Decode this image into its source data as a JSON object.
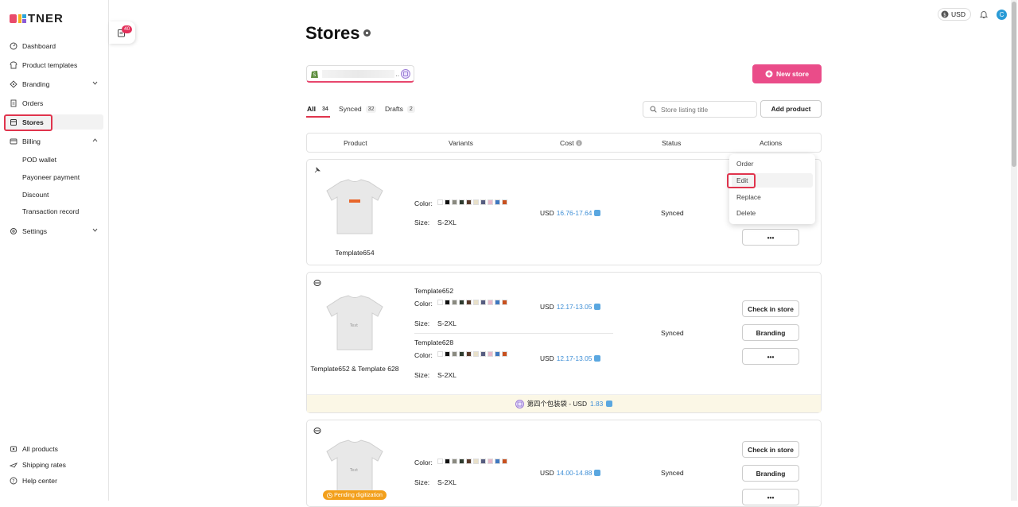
{
  "brand": {
    "name": "TNER",
    "logo_prefix": "PO"
  },
  "sidebar": {
    "items": [
      {
        "label": "Dashboard",
        "icon": "dashboard-icon"
      },
      {
        "label": "Product templates",
        "icon": "shirt-icon"
      },
      {
        "label": "Branding",
        "icon": "tag-icon"
      },
      {
        "label": "Orders",
        "icon": "orders-icon"
      },
      {
        "label": "Stores",
        "icon": "store-icon"
      },
      {
        "label": "Billing",
        "icon": "card-icon"
      },
      {
        "label": "Settings",
        "icon": "gear-icon"
      }
    ],
    "billing_sub": [
      "POD wallet",
      "Payoneer payment",
      "Discount",
      "Transaction record"
    ],
    "bottom": [
      {
        "label": "All products",
        "icon": "products-icon"
      },
      {
        "label": "Shipping rates",
        "icon": "shipping-icon"
      },
      {
        "label": "Help center",
        "icon": "help-icon"
      }
    ]
  },
  "notifications": {
    "count": "40"
  },
  "topbar": {
    "currency": "USD",
    "avatar": "C"
  },
  "page": {
    "title": "Stores"
  },
  "new_store_label": "New store",
  "tabs": [
    {
      "label": "All",
      "count": "34"
    },
    {
      "label": "Synced",
      "count": "32"
    },
    {
      "label": "Drafts",
      "count": "2"
    }
  ],
  "search": {
    "placeholder": "Store listing title"
  },
  "add_product_label": "Add product",
  "table_headers": [
    "Product",
    "Variants",
    "Cost",
    "Status",
    "Actions"
  ],
  "rows": [
    {
      "product": "Template654",
      "color_label": "Color:",
      "size_label": "Size:",
      "size": "S-2XL",
      "currency": "USD",
      "cost": "16.76-17.64",
      "status": "Synced"
    },
    {
      "product": "Template652 & Template 628",
      "variants": [
        {
          "name": "Template652",
          "size": "S-2XL",
          "currency": "USD",
          "cost": "12.17-13.05"
        },
        {
          "name": "Template628",
          "size": "S-2XL",
          "currency": "USD",
          "cost": "12.17-13.05"
        }
      ],
      "status": "Synced",
      "check_label": "Check in store",
      "branding_label": "Branding",
      "banner": {
        "text": "第四个包装袋 - USD",
        "value": "1.83"
      }
    },
    {
      "size": "S-2XL",
      "currency": "USD",
      "cost": "14.00-14.88",
      "status": "Synced",
      "check_label": "Check in store",
      "branding_label": "Branding",
      "pending_label": "Pending digitization"
    }
  ],
  "more_label": "•••",
  "shirt_print_text": "Text",
  "action_menu": [
    "Order",
    "Edit",
    "Replace",
    "Delete"
  ],
  "colors": {
    "accent": "#ea4c89",
    "highlight": "#e0344d",
    "link": "#3f8fd6",
    "swatches": [
      "#ffffff",
      "#111111",
      "#8a8a80",
      "#2e3b2e",
      "#5a3a2a",
      "#e8e0c8",
      "#565d80",
      "#e8b8c8",
      "#3f78c0",
      "#c8501e"
    ]
  }
}
